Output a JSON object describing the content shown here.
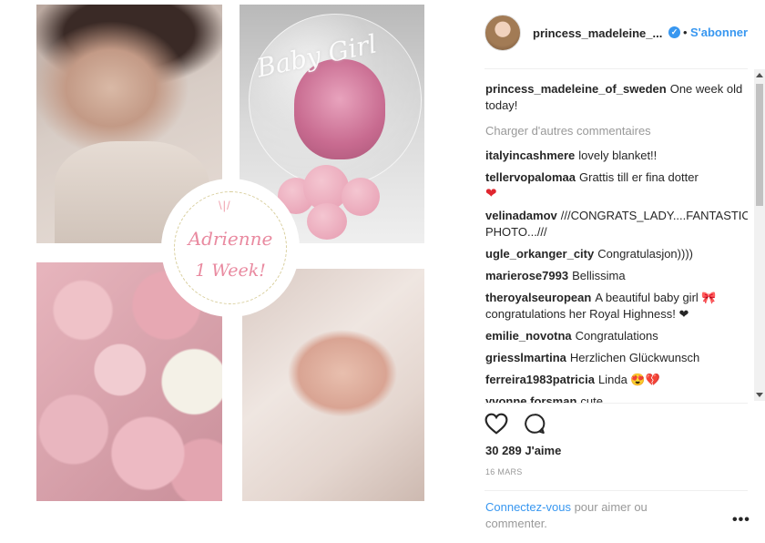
{
  "collage": {
    "balloon_text": "Baby Girl",
    "badge_name": "Adrienne",
    "badge_sub": "1 Week!"
  },
  "header": {
    "username": "princess_madeleine_...",
    "verified_icon": "verified-badge-icon",
    "separator": "•",
    "follow_label": "S'abonner"
  },
  "caption": {
    "user": "princess_madeleine_of_sweden",
    "text": "One week old today!"
  },
  "load_more": "Charger d'autres commentaires",
  "comments": [
    {
      "user": "italyincashmere",
      "text": "lovely blanket!!",
      "emoji": ""
    },
    {
      "user": "tellervopalomaa",
      "text": "Grattis till er fina dotter",
      "emoji": "❤"
    },
    {
      "user": "velinadamov",
      "text": "///CONGRATS_LADY....FANTASTIC PHOTO...///",
      "emoji": ""
    },
    {
      "user": "ugle_orkanger_city",
      "text": "Congratulasjon))))",
      "emoji": ""
    },
    {
      "user": "marierose7993",
      "text": "Bellissima",
      "emoji": ""
    },
    {
      "user": "theroyalseuropean",
      "text": "A beautiful baby girl 🎀 congratulations her Royal Highness! ❤",
      "emoji": ""
    },
    {
      "user": "emilie_novotna",
      "text": "Congratulations",
      "emoji": ""
    },
    {
      "user": "griesslmartina",
      "text": "Herzlichen Glückwunsch",
      "emoji": ""
    },
    {
      "user": "ferreira1983patricia",
      "text": "Linda 😍💔",
      "emoji": ""
    },
    {
      "user": "yvonne.forsman",
      "text": "cute",
      "emoji": ""
    }
  ],
  "actions": {
    "like_icon": "heart-outline-icon",
    "comment_icon": "comment-bubble-icon"
  },
  "likes": "30 289 J'aime",
  "date": "16 MARS",
  "login": {
    "link": "Connectez-vous",
    "rest": " pour aimer ou commenter."
  },
  "more_label": "•••",
  "colors": {
    "accent": "#3897f0",
    "muted": "#999999",
    "text": "#262626"
  }
}
